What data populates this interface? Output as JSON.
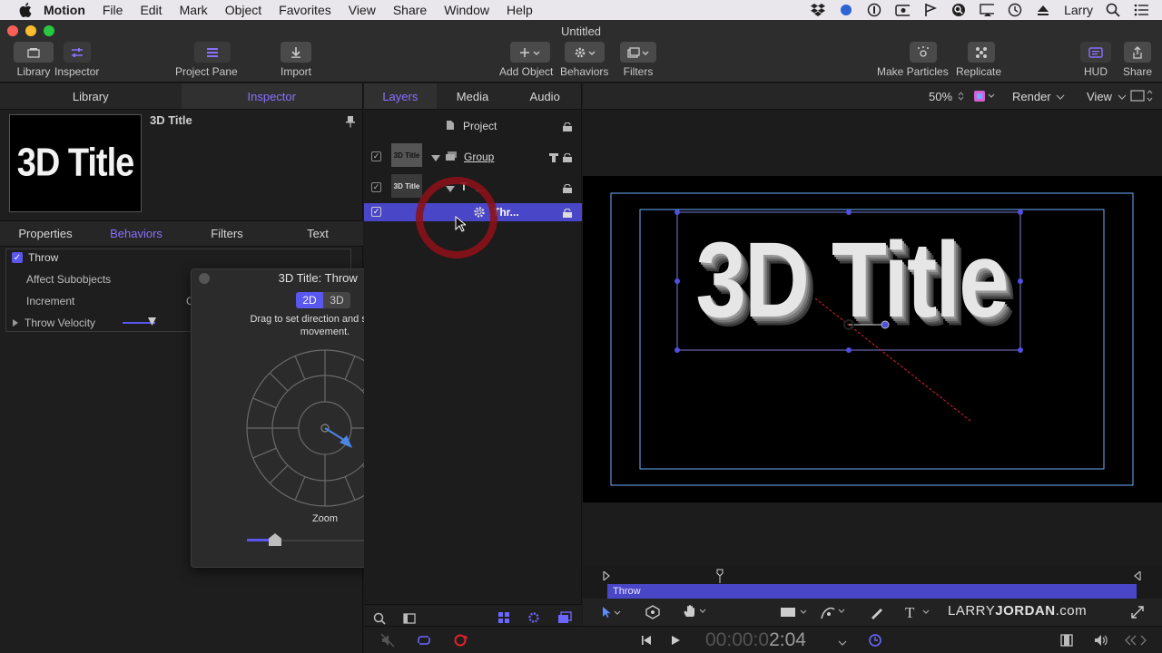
{
  "menubar": {
    "app": "Motion",
    "items": [
      "File",
      "Edit",
      "Mark",
      "Object",
      "Favorites",
      "View",
      "Share",
      "Window",
      "Help"
    ],
    "user": "Larry"
  },
  "window": {
    "title": "Untitled"
  },
  "toolbar": {
    "library": "Library",
    "inspector": "Inspector",
    "project_pane": "Project Pane",
    "import": "Import",
    "add_object": "Add Object",
    "behaviors": "Behaviors",
    "filters": "Filters",
    "make_particles": "Make Particles",
    "replicate": "Replicate",
    "hud": "HUD",
    "share": "Share"
  },
  "left_panel": {
    "tabs": [
      "Library",
      "Inspector"
    ],
    "active_tab": "Inspector",
    "preview_text": "3D Title",
    "layer_name": "3D Title",
    "sub_tabs": [
      "Properties",
      "Behaviors",
      "Filters",
      "Text"
    ],
    "behavior": {
      "name": "Throw",
      "affect_subobjects": "Affect Subobjects",
      "increment": "Increment",
      "increment_value": "C",
      "throw_velocity": "Throw Velocity"
    }
  },
  "hud": {
    "title": "3D Title: Throw",
    "mode_2d": "2D",
    "mode_3d": "3D",
    "active_mode": "2D",
    "instructions": "Drag to set direction and speed of movement.",
    "zoom_label": "Zoom",
    "zoom_level": 0.18
  },
  "layers_panel": {
    "tabs": [
      "Layers",
      "Media",
      "Audio"
    ],
    "active_tab": "Layers",
    "rows": {
      "project": "Project",
      "group": "Group",
      "title_thumb": "3D Title",
      "text_layer": "...",
      "throw": "Thr..."
    }
  },
  "canvas": {
    "zoom": "50%",
    "render": "Render",
    "view": "View",
    "title_text": "3D Title"
  },
  "timeline": {
    "bar_label": "Throw"
  },
  "transport": {
    "timecode_dim": "00:00:0",
    "timecode_bright": "2:04"
  },
  "watermark": {
    "part1": "LARRY",
    "part2": "JORDAN",
    "part3": ".com"
  },
  "colors": {
    "accent": "#5a56f0",
    "tab_active": "#8a70ff",
    "selection": "#4a46c8",
    "guide": "#6db0ff"
  }
}
